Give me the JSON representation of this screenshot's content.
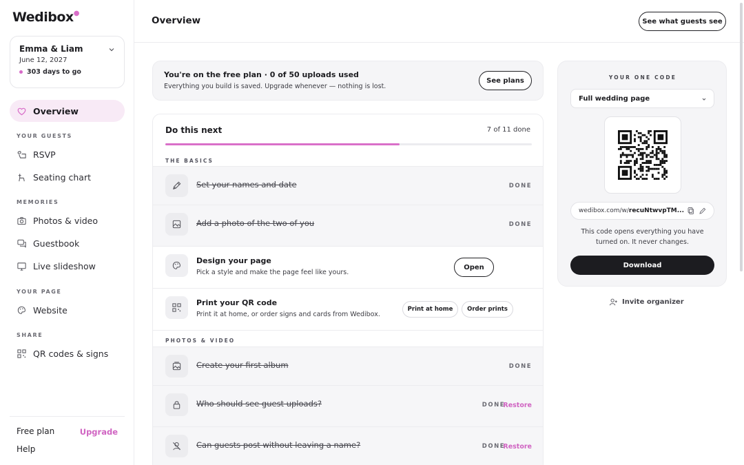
{
  "sidebar": {
    "logo": "Wedibox",
    "event": {
      "name": "Emma & Liam",
      "date": "June 12, 2027",
      "countdown": "303 days to go"
    },
    "nav": {
      "overview": "Overview",
      "section_guests": "YOUR GUESTS",
      "rsvp": "RSVP",
      "seating": "Seating chart",
      "section_memories": "MEMORIES",
      "photos": "Photos & video",
      "guestbook": "Guestbook",
      "slideshow": "Live slideshow",
      "section_page": "YOUR PAGE",
      "website": "Website",
      "section_share": "SHARE",
      "qr": "QR codes & signs"
    },
    "footer": {
      "plan": "Free plan",
      "upgrade": "Upgrade",
      "help": "Help"
    }
  },
  "header": {
    "title": "Overview",
    "preview_button": "See what guests see"
  },
  "plan_banner": {
    "title": "You're on the free plan · 0 of 50 uploads used",
    "subtitle": "Everything you build is saved. Upgrade whenever — nothing is lost.",
    "button": "See plans"
  },
  "tasks": {
    "title": "Do this next",
    "progress_text": "7 of 11 done",
    "progress": 0.64,
    "group_basics": "THE BASICS",
    "group_photos": "PHOTOS & VIDEO",
    "done_label": "DONE",
    "restore_label": "Restore",
    "items": {
      "names": {
        "title": "Set your names and date"
      },
      "photo": {
        "title": "Add a photo of the two of you"
      },
      "design": {
        "title": "Design your page",
        "desc": "Pick a style and make the page feel like yours.",
        "button": "Open"
      },
      "print": {
        "title": "Print your QR code",
        "desc": "Print it at home, or order signs and cards from Wedibox.",
        "button_home": "Print at home",
        "button_order": "Order prints"
      },
      "album": {
        "title": "Create your first album"
      },
      "uploads": {
        "title": "Who should see guest uploads?"
      },
      "anonymous": {
        "title": "Can guests post without leaving a name?"
      }
    }
  },
  "code_card": {
    "label": "YOUR ONE CODE",
    "select_value": "Full wedding page",
    "url_prefix": "wedibox.com/w/",
    "url_code": "recuNtwvpTM...",
    "description": "This code opens everything you have turned on. It never changes.",
    "download": "Download"
  },
  "invite": "Invite organizer",
  "colors": {
    "accent": "#d96fc9",
    "dark": "#1c1c20",
    "panel": "#f5f5f7"
  }
}
